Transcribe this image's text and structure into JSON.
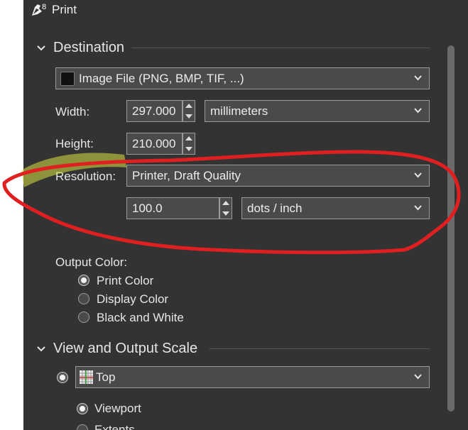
{
  "window": {
    "title": "Print",
    "icon": "rhino-8-icon"
  },
  "destination": {
    "header": "Destination",
    "device": "Image File (PNG, BMP, TIF, ...)",
    "width_label": "Width:",
    "width_value": "297.000",
    "units": "millimeters",
    "height_label": "Height:",
    "height_value": "210.000",
    "resolution_label": "Resolution:",
    "resolution_preset": "Printer, Draft Quality",
    "dpi_value": "100.0",
    "dpi_units": "dots / inch",
    "output_color_label": "Output Color:",
    "output_color_options": [
      "Print Color",
      "Display Color",
      "Black and White"
    ],
    "output_color_selected": "Print Color"
  },
  "view_scale": {
    "header": "View and Output Scale",
    "view": "Top",
    "viewport_label": "Viewport",
    "next_option_partial": "Extents"
  },
  "colors": {
    "panel_bg": "#333333",
    "field_bg": "#4a4a4a",
    "annotation_red": "#e02020",
    "highlighter_yellow": "#d8e040"
  }
}
